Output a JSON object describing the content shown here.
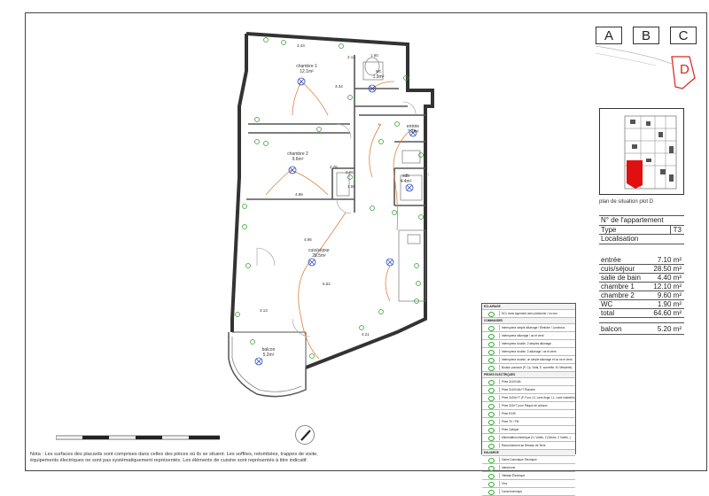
{
  "grid": {
    "columns": [
      "A",
      "B",
      "C"
    ],
    "selected": "D"
  },
  "site_plan": {
    "caption": "plan de situation plot D"
  },
  "apartment": {
    "number_label": "N° de l'appartement",
    "type_label": "Type",
    "type_value": "T3",
    "location_label": "Localisation"
  },
  "areas": [
    {
      "room": "entrée",
      "area": "7.10 m²"
    },
    {
      "room": "cuis/séjour",
      "area": "28.50 m²"
    },
    {
      "room": "salle de bain",
      "area": "4.40 m²"
    },
    {
      "room": "chambre 1",
      "area": "12.10 m²"
    },
    {
      "room": "chambre 2",
      "area": "9.60 m²"
    },
    {
      "room": "WC",
      "area": "1.90 m²"
    },
    {
      "room": "total",
      "area": "64.60 m²"
    }
  ],
  "balcony": {
    "room": "balcon",
    "area": "5.20 m²"
  },
  "plan_labels": {
    "chambre1": "chambre 1",
    "chambre1_area": "12.1m²",
    "chambre2": "chambre 2",
    "chambre2_area": "9.6m²",
    "wc": "wc",
    "wc_area": "1.9m²",
    "entree": "entrée",
    "entree_area": "7.1m²",
    "sdb": "sdb",
    "sdb_area": "4.4m²",
    "sejour": "cuis/séjour",
    "sejour_area": "28.5m²",
    "balcon": "balcon",
    "balcon_area": "5.2m²",
    "dims": [
      "3.43",
      "1.60",
      "2.12",
      "3.34",
      "2.75",
      "0.66",
      "1.50",
      "4.95",
      "5.52",
      "4.21",
      "3.13",
      "4.88"
    ]
  },
  "legend": {
    "sections": [
      {
        "title": "ECLAIRAGE",
        "items": [
          "DCL dans logement avec plafonnier / ou mur"
        ]
      },
      {
        "title": "COMMANDES",
        "items": [
          "Interrupteur simple allumage / Éteindre / Lumineux",
          "Interrupteur allumage / va et vient",
          "Interrupteur double, 2 simples allumage",
          "Interrupteur double, 2 allumage / va et vient",
          "Interrupteur double, un simple allumage et un va et vient",
          "Bouton poussoir (P, Cp, Volts, E. sonnette, M. Minuterie)"
        ]
      },
      {
        "title": "PRISES ELECTRIQUES",
        "items": [
          "Prise 2x10/16A",
          "Prise 2x10/16A+T Étanche",
          "Prise 2x20A+T (P, Four, LV, Lave-linge, LL, Lave-vaisselle)",
          "Prise 32A+T pour Plaque de cuisson",
          "Prise RJ45",
          "Prise TV / FM",
          "Prise Optique",
          "Alimentation électrique (H. Volets, 2 (Sèche, 2 Volets...)",
          "Raccordement au Réseau de Terre"
        ]
      },
      {
        "title": "EAU/ARGE",
        "items": [
          "Gaine Domotique Electrique",
          "Interphone",
          "Tableau Électrique",
          "Vmc",
          "Canal technique"
        ]
      }
    ]
  },
  "note": "Nota : Les surfaces des placards sont comprises dans celles des pièces où ils se situent. Les soffites, retombées, trappes de visite, équipements électriques ne sont pas systématiquement représentés. Les éléments de cuisine sont représentés à titre indicatif."
}
